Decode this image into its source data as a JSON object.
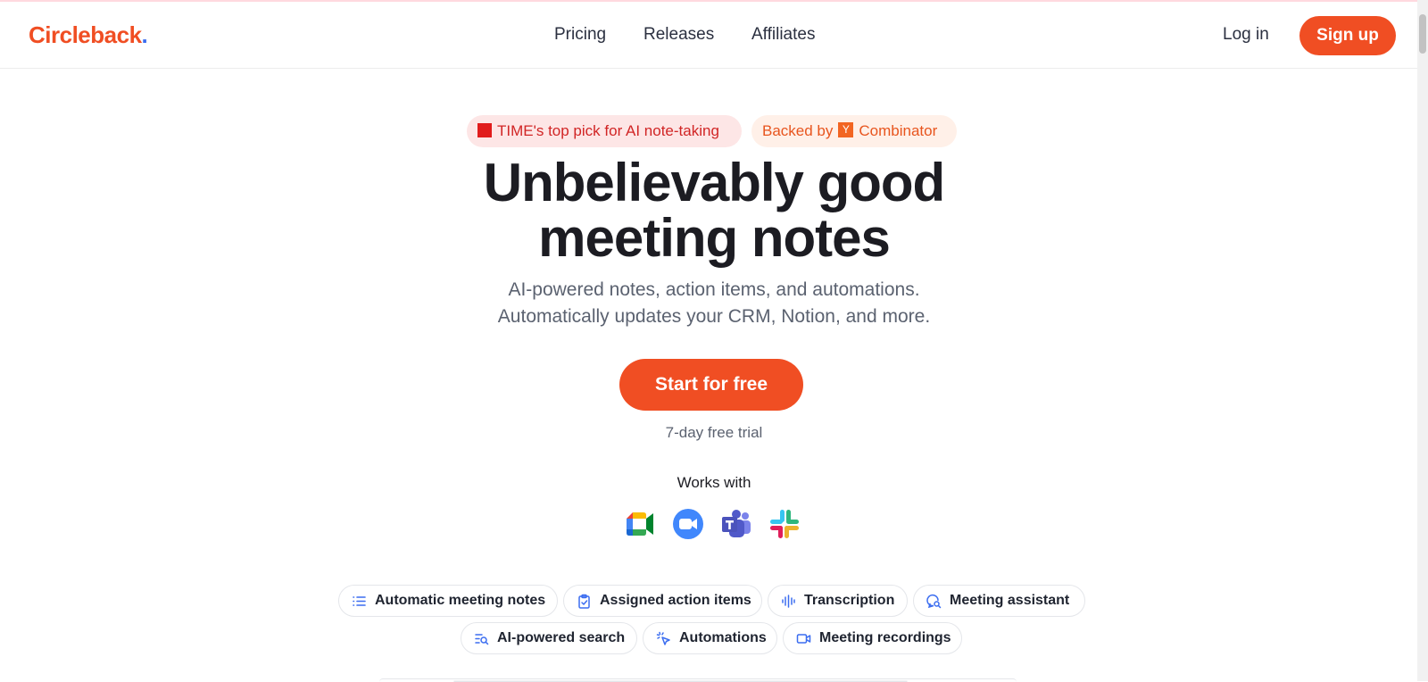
{
  "header": {
    "logo": "Circleback",
    "logo_dot": ".",
    "nav": [
      "Pricing",
      "Releases",
      "Affiliates"
    ],
    "login": "Log in",
    "signup": "Sign up"
  },
  "badges": {
    "time": "TIME's top pick for AI note-taking",
    "time_logo": "TIME",
    "backed_by": "Backed by",
    "yc_logo": "Y",
    "combinator": "Combinator"
  },
  "hero": {
    "headline_line1": "Unbelievably good",
    "headline_line2": "meeting notes",
    "sub_line1": "AI-powered notes, action items, and automations.",
    "sub_line2": "Automatically updates your CRM, Notion, and more.",
    "cta": "Start for free",
    "trial": "7-day free trial",
    "works_with": "Works with"
  },
  "integrations": [
    "google-meet-icon",
    "zoom-icon",
    "microsoft-teams-icon",
    "slack-icon"
  ],
  "features": [
    "Automatic meeting notes",
    "Assigned action items",
    "Transcription",
    "Meeting assistant",
    "AI-powered search",
    "Automations",
    "Meeting recordings"
  ],
  "colors": {
    "brand": "#f04e23",
    "accent": "#3b6df0",
    "time_red": "#d12525"
  }
}
